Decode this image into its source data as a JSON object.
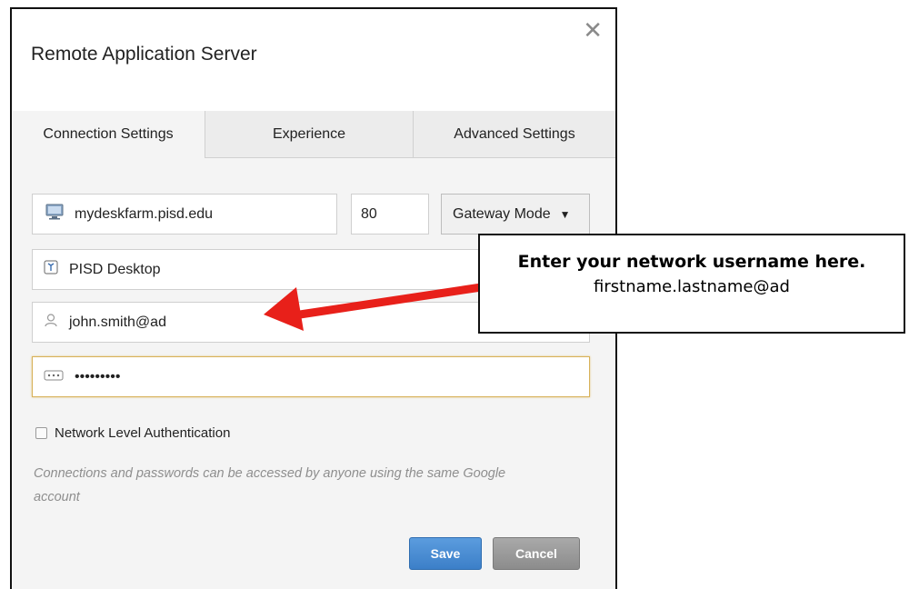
{
  "dialog": {
    "title": "Remote Application Server",
    "close_glyph": "✕"
  },
  "tabs": [
    {
      "label": "Connection Settings",
      "active": true
    },
    {
      "label": "Experience",
      "active": false
    },
    {
      "label": "Advanced Settings",
      "active": false
    }
  ],
  "form": {
    "host": "mydeskfarm.pisd.edu",
    "port": "80",
    "mode": {
      "selected": "Gateway Mode"
    },
    "name": "PISD Desktop",
    "username": "john.smith@ad",
    "password": "•••••••••",
    "nla_label": "Network Level Authentication",
    "nla_checked": false,
    "note": "Connections and passwords can be accessed by anyone using the same Google account"
  },
  "buttons": {
    "save": "Save",
    "cancel": "Cancel"
  },
  "callout": {
    "title": "Enter your network username here.",
    "subtitle": "firstname.lastname@ad"
  },
  "icons": {
    "host": "monitor-icon",
    "name": "bookmark-icon",
    "user": "user-icon",
    "password": "password-icon"
  },
  "colors": {
    "save_button": "#3c7fc8",
    "cancel_button": "#8c8c8c",
    "arrow": "#e8201a",
    "focus_border": "#d8b25a"
  }
}
